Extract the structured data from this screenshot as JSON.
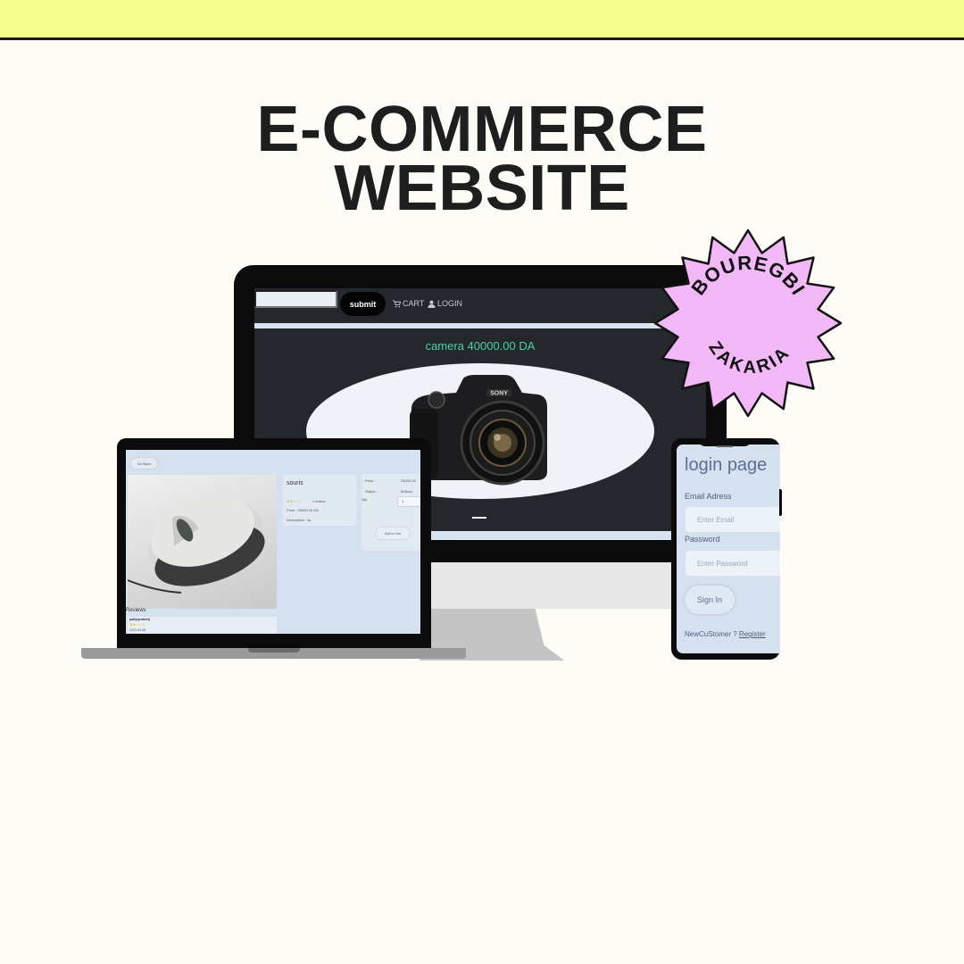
{
  "headline": {
    "line1": "E-COMMERCE",
    "line2": "WEBSITE"
  },
  "badge": {
    "top_text": "BOUREGBI",
    "bottom_text": "ZAKARIA",
    "color": "#f2b8f7"
  },
  "desktop": {
    "submit_label": "submit",
    "cart_label": "CART",
    "login_label": "LOGIN",
    "product_title": "camera 40000.00 DA",
    "title_color": "#49d3a3"
  },
  "laptop": {
    "back_label": "Go Back",
    "product_name": "souris",
    "review_count": "1 reviews",
    "price_line": "Price : 25000.00 DA",
    "description_line": "Description : ss",
    "price_label": "Price :",
    "price_value": "25000.00",
    "status_label": "Status :",
    "status_value": "inStock",
    "qty_label": "Qty",
    "qty_value": "1",
    "add_to_cart_label": "Add to Cart",
    "reviews_title": "Reviews",
    "review": {
      "author": "jadk(updated)",
      "date": "2023-03-08"
    }
  },
  "phone": {
    "title": "login page",
    "email_label": "Email Adress",
    "email_placeholder": "Enter Email",
    "password_label": "Password",
    "password_placeholder": "Enter Password",
    "signin_label": "Sign In",
    "footer_text": "NewCuStomer ? ",
    "register_label": "Register"
  },
  "colors": {
    "top_band": "#f5ff8e",
    "background": "#fdfcf6",
    "screen_accent": "#d6e1ef"
  }
}
